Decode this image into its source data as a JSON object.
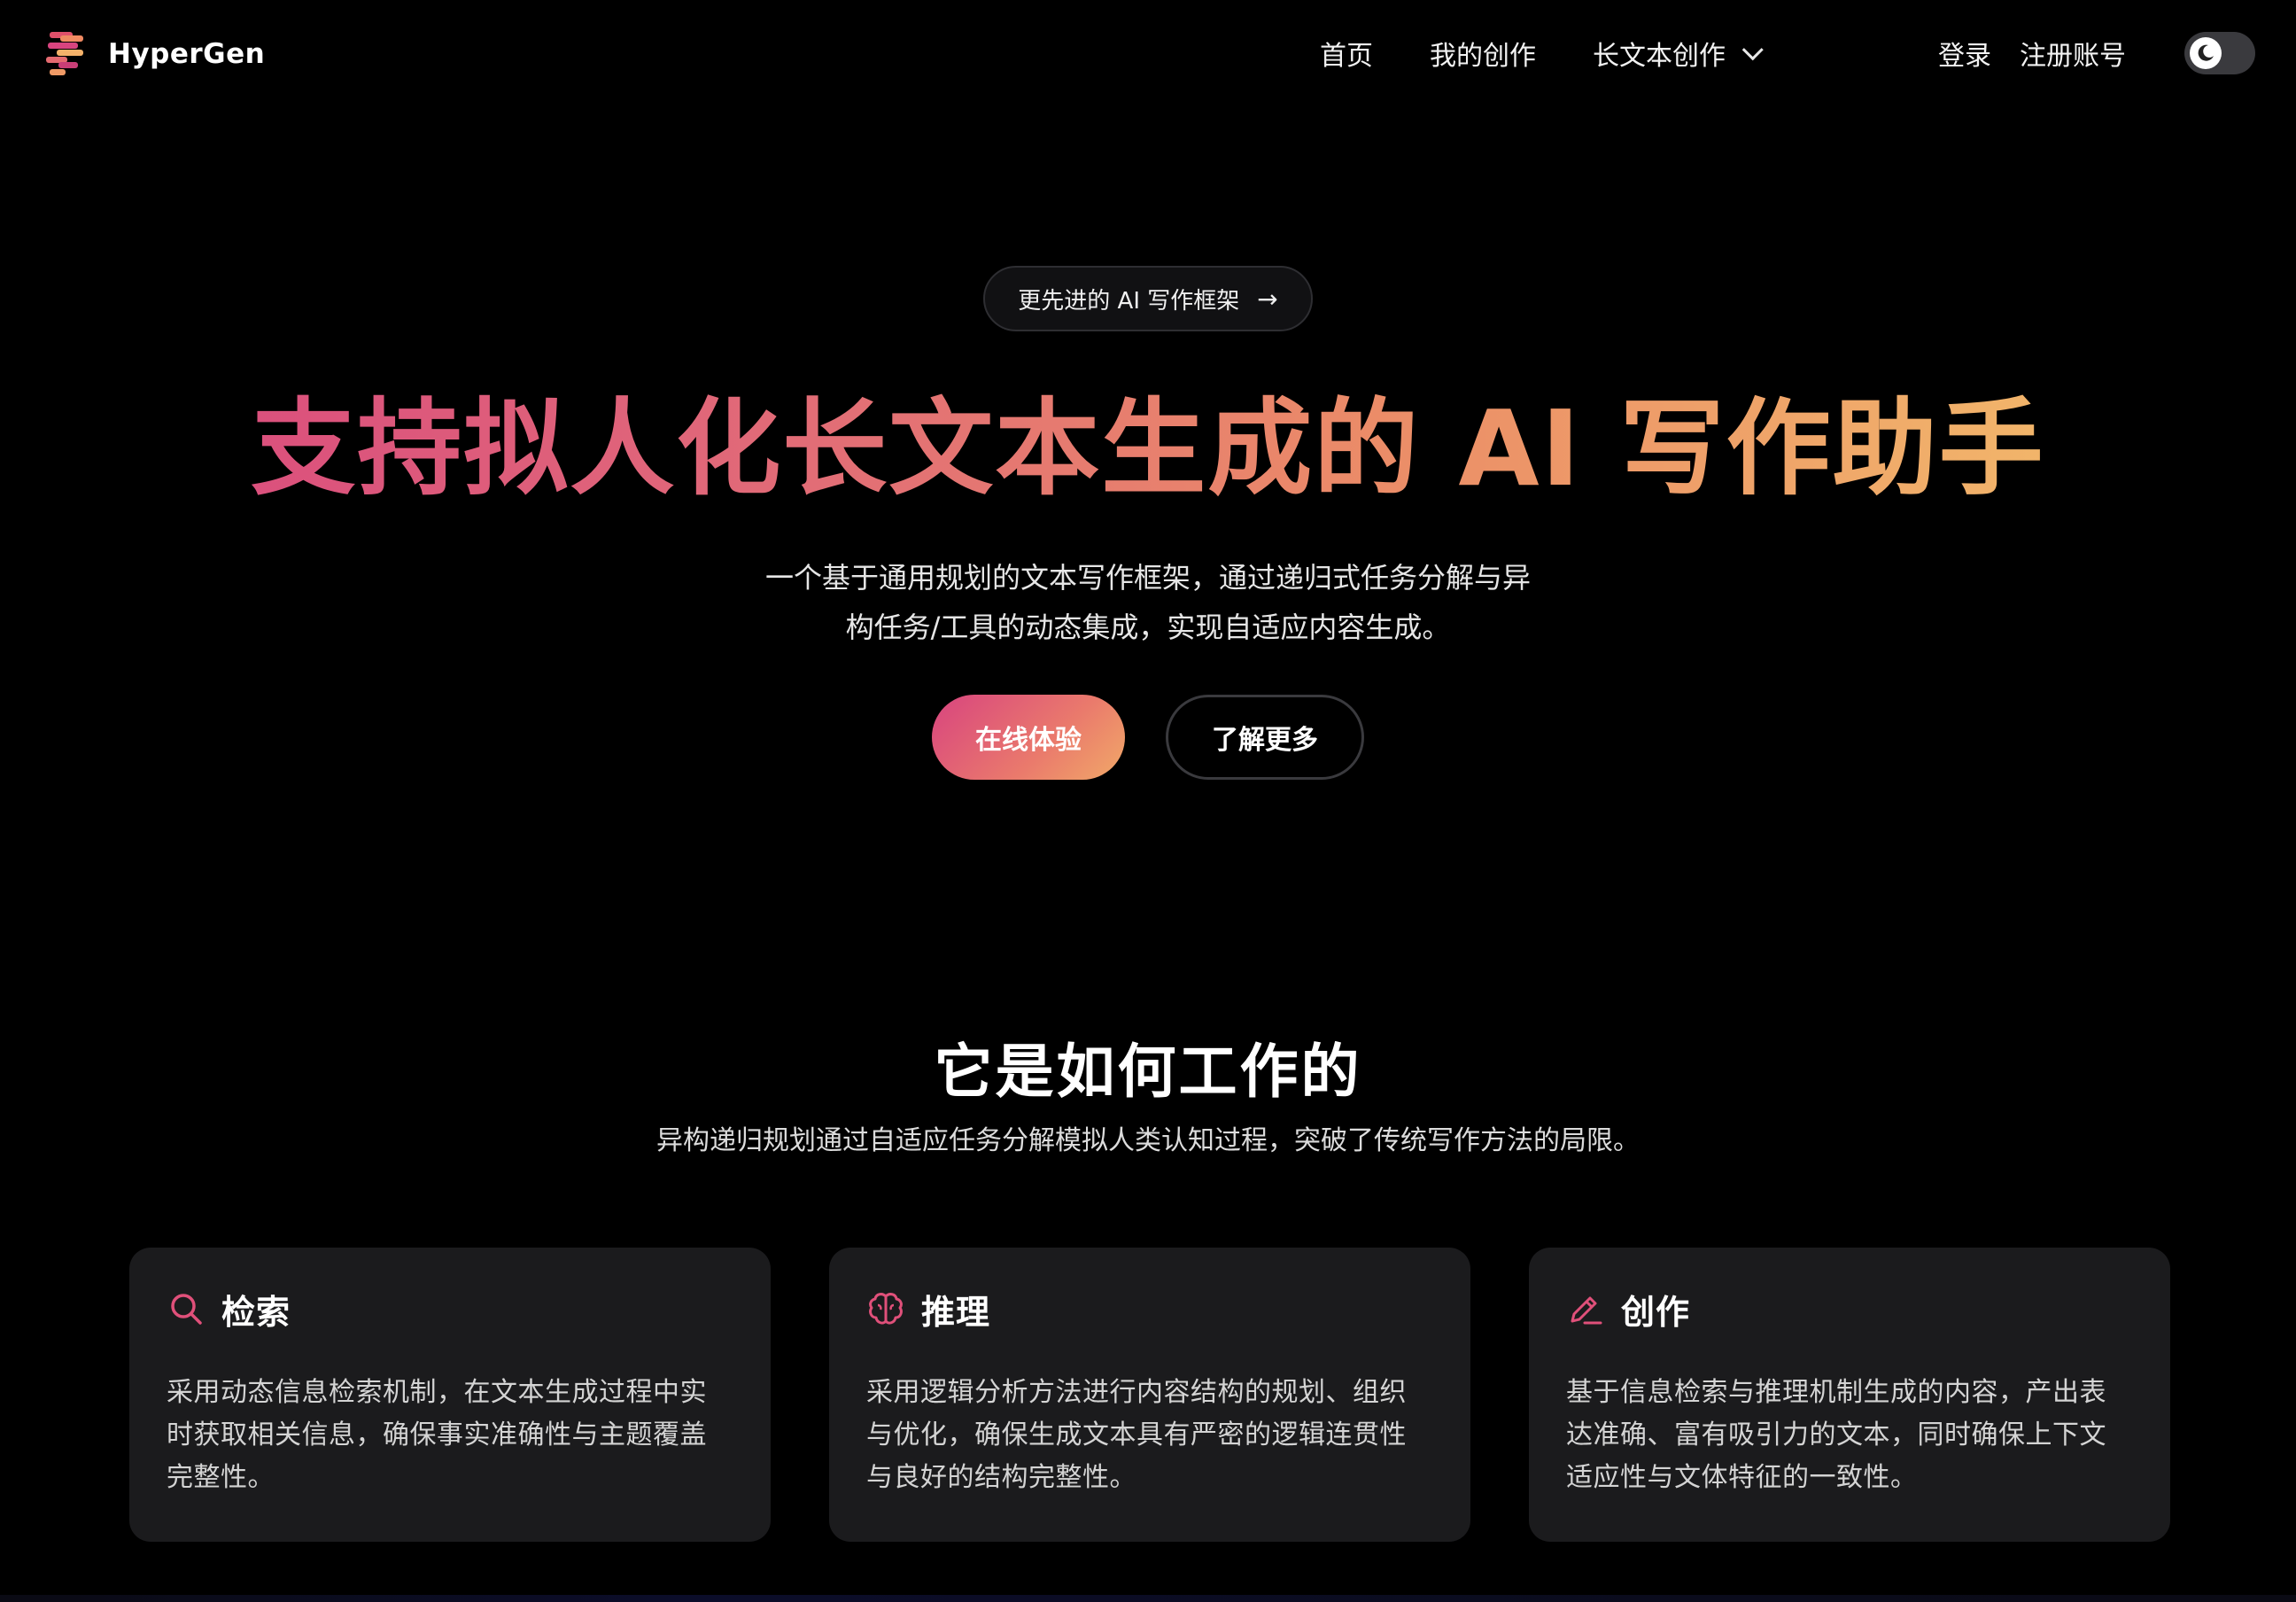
{
  "nav": {
    "brand": "HyperGen",
    "links": [
      "首页",
      "我的创作",
      "长文本创作"
    ],
    "login": "登录",
    "register": "注册账号"
  },
  "hero": {
    "badge": "更先进的 AI 写作框架",
    "title": "支持拟人化长文本生成的 AI 写作助手",
    "subtitle_line1": "一个基于通用规划的文本写作框架，通过递归式任务分解与异",
    "subtitle_line2": "构任务/工具的动态集成，实现自适应内容生成。",
    "cta_primary": "在线体验",
    "cta_secondary": "了解更多"
  },
  "how": {
    "title": "它是如何工作的",
    "subtitle": "异构递归规划通过自适应任务分解模拟人类认知过程，突破了传统写作方法的局限。",
    "cards": [
      {
        "icon": "search-icon",
        "title": "检索",
        "body": "采用动态信息检索机制，在文本生成过程中实时获取相关信息，确保事实准确性与主题覆盖完整性。"
      },
      {
        "icon": "brain-icon",
        "title": "推理",
        "body": "采用逻辑分析方法进行内容结构的规划、组织与优化，确保生成文本具有严密的逻辑连贯性与良好的结构完整性。"
      },
      {
        "icon": "pencil-icon",
        "title": "创作",
        "body": "基于信息检索与推理机制生成的内容，产出表达准确、富有吸引力的文本，同时确保上下文适应性与文体特征的一致性。"
      }
    ]
  },
  "colors": {
    "accent_pink": "#d8447f",
    "accent_orange": "#eb8c68",
    "accent_yellow": "#f4c46b",
    "card_bg": "#1b1b1d",
    "page_bg": "#000000"
  }
}
